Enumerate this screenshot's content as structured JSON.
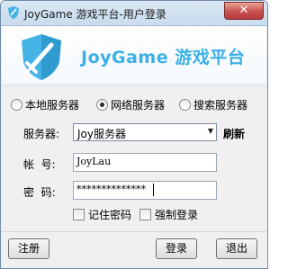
{
  "window": {
    "title": "JoyGame 游戏平台-用户登录",
    "close_glyph": "✕"
  },
  "banner": {
    "brand": "JoyGame 游戏平台",
    "brand_color": "#3ab0e6",
    "icon": "shield-sword-icon"
  },
  "server_mode": {
    "options": [
      {
        "label": "本地服务器",
        "selected": false
      },
      {
        "label": "网络服务器",
        "selected": true
      },
      {
        "label": "搜索服务器",
        "selected": false
      }
    ]
  },
  "form": {
    "server_label": "服务器:",
    "server_value": "Joy服务器",
    "refresh_label": "刷新",
    "account_label": "帐  号:",
    "account_value": "JoyLau",
    "password_label": "密  码:",
    "password_value": "**************",
    "remember_label": "记住密码",
    "force_label": "强制登录"
  },
  "buttons": {
    "register": "注册",
    "login": "登录",
    "exit": "退出"
  }
}
